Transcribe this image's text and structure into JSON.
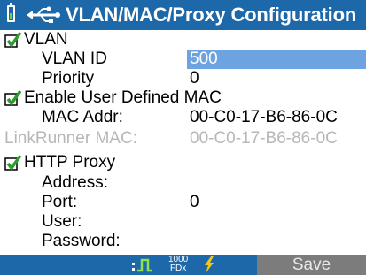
{
  "title": "VLAN/MAC/Proxy Configuration",
  "rows": {
    "vlan": "VLAN",
    "vlan_id_label": "VLAN ID",
    "vlan_id_value": "500",
    "priority_label": "Priority",
    "priority_value": "0",
    "enable_mac": "Enable User Defined MAC",
    "mac_label": "MAC Addr:",
    "mac_value": "00-C0-17-B6-86-0C",
    "lr_mac_label": "LinkRunner MAC:",
    "lr_mac_value": "00-C0-17-B6-86-0C",
    "http_proxy": "HTTP Proxy",
    "address_label": "Address:",
    "port_label": "Port:",
    "port_value": "0",
    "user_label": "User:",
    "password_label": "Password:"
  },
  "statusbar": {
    "speed_top": "1000",
    "speed_bottom": "FDx",
    "save_label": "Save",
    "icons": [
      "link-pulse-icon",
      "power-bolt-icon"
    ]
  },
  "colors": {
    "titlebar": "#1d68a8",
    "highlight": "#6da3e0",
    "check": "#2e9d2e",
    "disabled_text": "#b7b7b7"
  }
}
